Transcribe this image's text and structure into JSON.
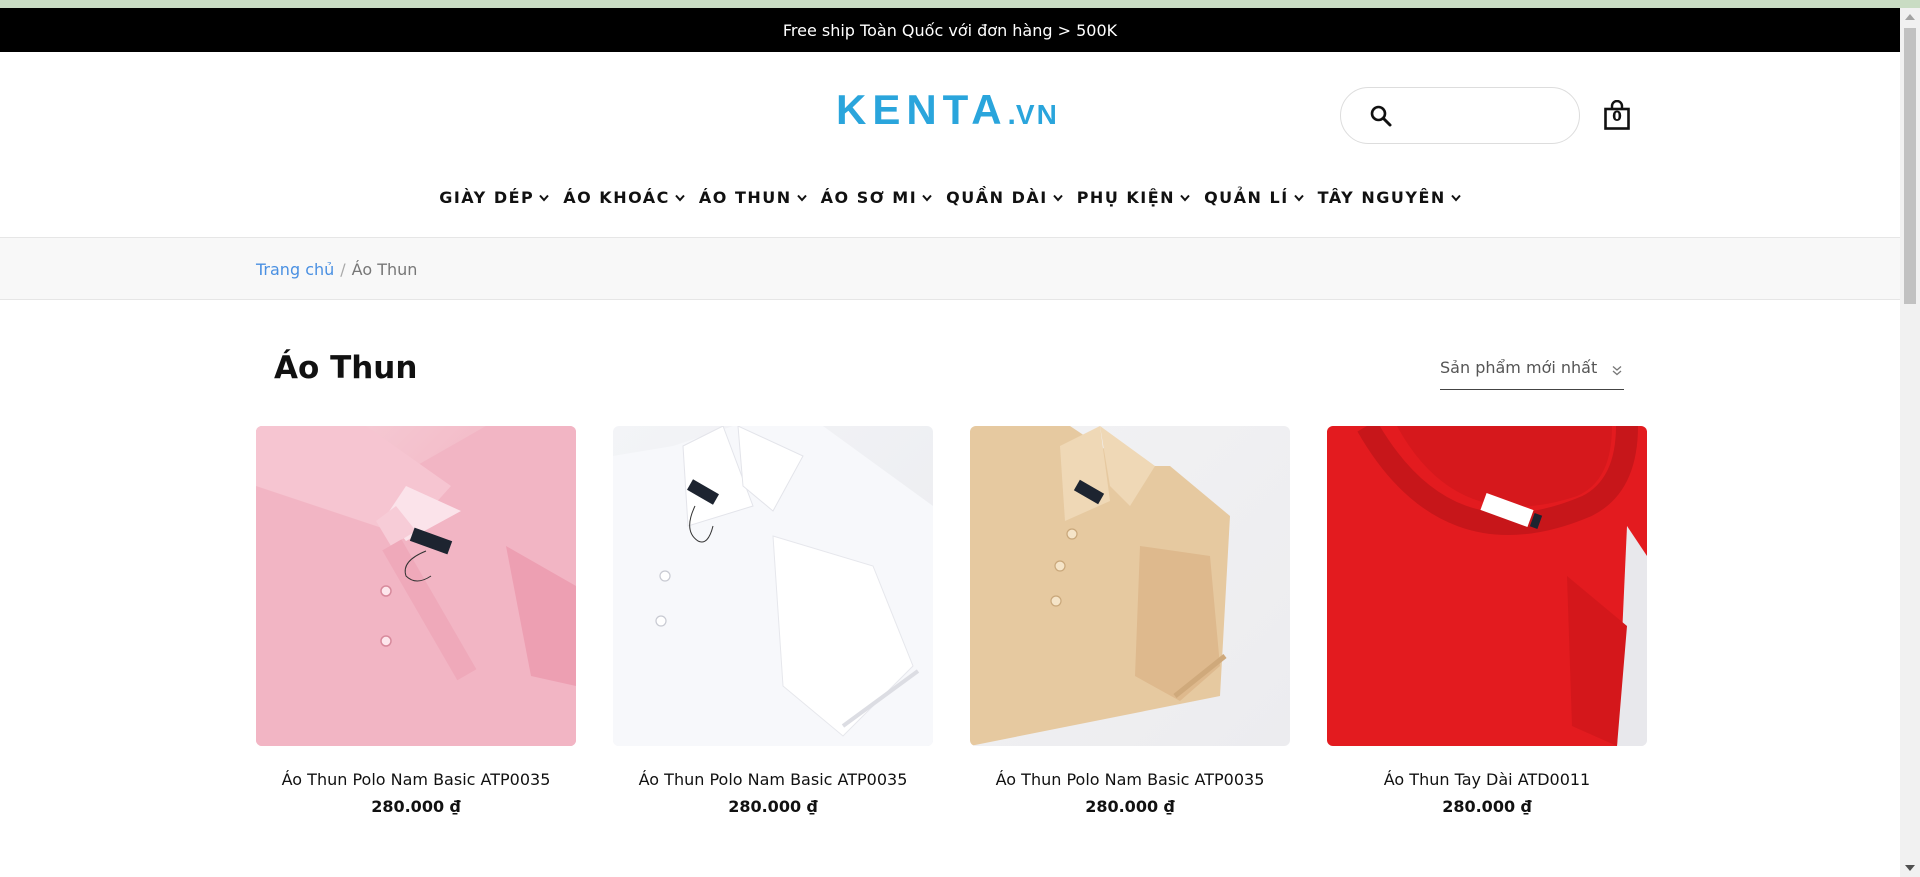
{
  "announcement": "Free ship Toàn Quốc với đơn hàng > 500K",
  "logo": {
    "main": "KENTA",
    "dot": ".",
    "suffix": "VN"
  },
  "search": {
    "placeholder": "",
    "icon": "search-icon"
  },
  "cart": {
    "count": "0",
    "icon": "shopping-bag-icon"
  },
  "nav": [
    {
      "label": "GIÀY DÉP"
    },
    {
      "label": "ÁO KHOÁC"
    },
    {
      "label": "ÁO THUN"
    },
    {
      "label": "ÁO SƠ MI"
    },
    {
      "label": "QUẦN DÀI"
    },
    {
      "label": "PHỤ KIỆN"
    },
    {
      "label": "QUẢN LÍ"
    },
    {
      "label": "TÂY NGUYÊN"
    }
  ],
  "breadcrumb": {
    "home": "Trang chủ",
    "separator": "/",
    "current": "Áo Thun"
  },
  "page_title": "Áo Thun",
  "sort": {
    "selected": "Sản phẩm mới nhất"
  },
  "products": [
    {
      "name": "Áo Thun Polo Nam Basic ATP0035",
      "price": "280.000 ₫",
      "color": "#f3b5c3"
    },
    {
      "name": "Áo Thun Polo Nam Basic ATP0035",
      "price": "280.000 ₫",
      "color": "#f4f5f8"
    },
    {
      "name": "Áo Thun Polo Nam Basic ATP0035",
      "price": "280.000 ₫",
      "color": "#e8cca3"
    },
    {
      "name": "Áo Thun Tay Dài ATD0011",
      "price": "280.000 ₫",
      "color": "#e31b1f"
    }
  ],
  "colors": {
    "accent": "#2aa5dc",
    "link": "#4a90e2",
    "announcement_bg": "#000000"
  }
}
